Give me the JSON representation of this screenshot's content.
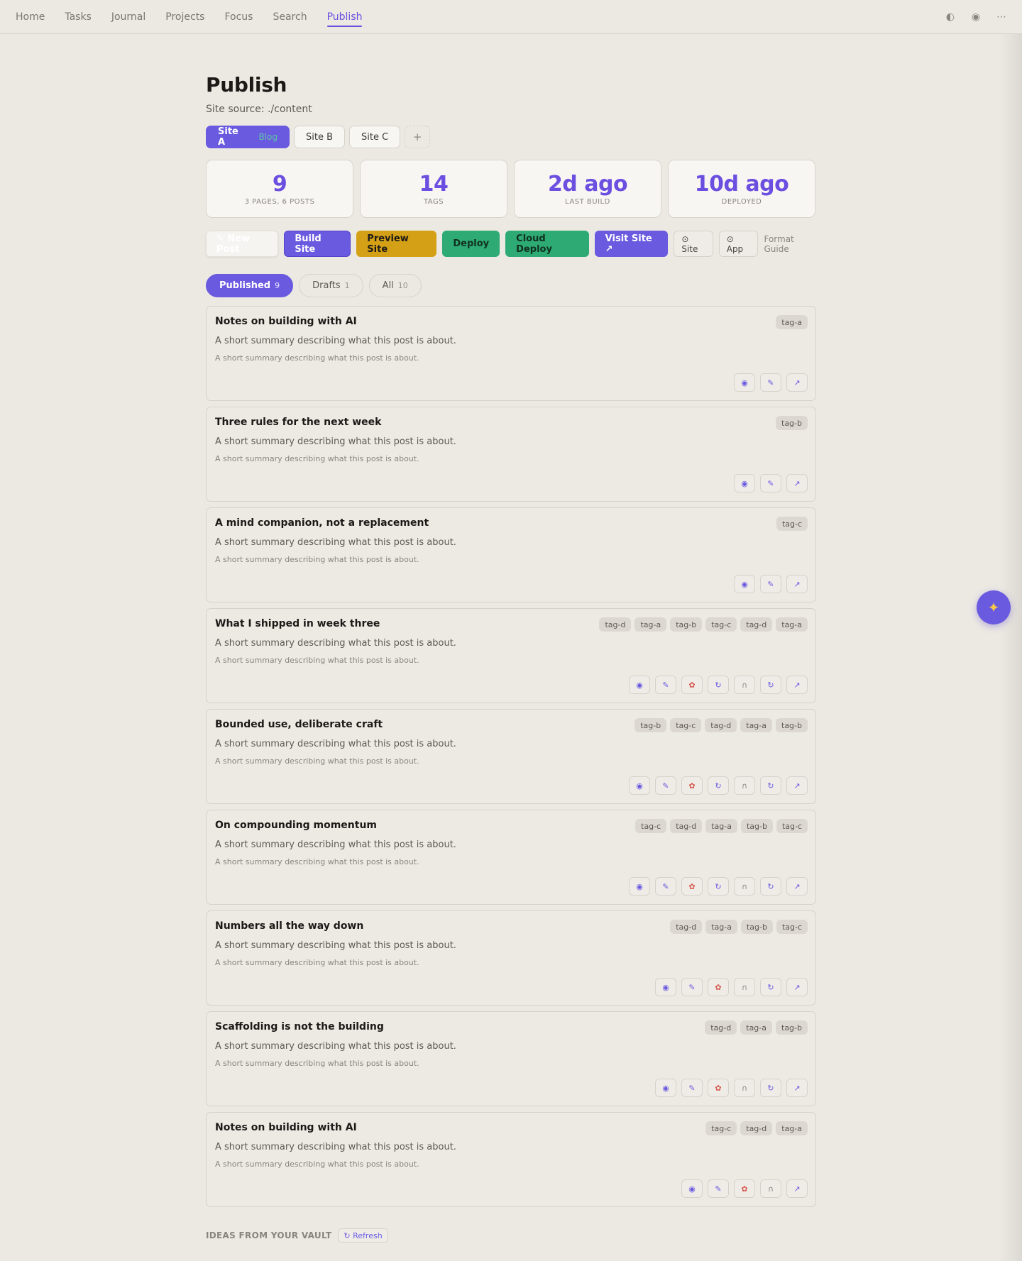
{
  "nav": {
    "items": [
      {
        "label": "Home"
      },
      {
        "label": "Tasks"
      },
      {
        "label": "Journal"
      },
      {
        "label": "Projects"
      },
      {
        "label": "Focus"
      },
      {
        "label": "Search"
      },
      {
        "label": "Publish",
        "active": true
      }
    ],
    "icons": [
      "theme-toggle-icon",
      "eye-icon",
      "more-icon"
    ],
    "icon_glyphs": [
      "◐",
      "◉",
      "⋯"
    ]
  },
  "page": {
    "title": "Publish",
    "site_source": "Site source: ./content"
  },
  "site_tabs": [
    {
      "label": "Site A",
      "badge": "Blog",
      "active": true
    },
    {
      "label": "Site B"
    },
    {
      "label": "Site C"
    }
  ],
  "add_site_label": "+",
  "stats": [
    {
      "value": "9",
      "label": "3 PAGES, 6 POSTS"
    },
    {
      "value": "14",
      "label": "TAGS"
    },
    {
      "value": "2d ago",
      "label": "LAST BUILD"
    },
    {
      "value": "10d ago",
      "label": "DEPLOYED"
    }
  ],
  "actions": {
    "new_post": "✎ New Post",
    "build": "Build Site",
    "preview": "Preview Site",
    "deploy": "Deploy",
    "cloud_deploy": "Cloud Deploy",
    "visit": "Visit Site ↗",
    "site": "⊙ Site",
    "app": "⊙ App",
    "format_guide": "Format Guide"
  },
  "filters": [
    {
      "label": "Published",
      "count": "9",
      "active": true
    },
    {
      "label": "Drafts",
      "count": "1"
    },
    {
      "label": "All",
      "count": "10"
    }
  ],
  "posts": [
    {
      "title": "Notes on building with AI",
      "summary": "A short summary describing what this post is about.",
      "sub": "A short summary describing what this post is about.",
      "tags": [
        "tag-a"
      ],
      "actions": [
        "view",
        "edit",
        "open"
      ]
    },
    {
      "title": "Three rules for the next week",
      "summary": "A short summary describing what this post is about.",
      "sub": "A short summary describing what this post is about.",
      "tags": [
        "tag-b"
      ],
      "actions": [
        "view",
        "edit",
        "open"
      ]
    },
    {
      "title": "A mind companion, not a replacement",
      "summary": "A short summary describing what this post is about.",
      "sub": "A short summary describing what this post is about.",
      "tags": [
        "tag-c"
      ],
      "actions": [
        "view",
        "edit",
        "open"
      ]
    },
    {
      "title": "What I shipped in week three",
      "summary": "A short summary describing what this post is about.",
      "sub": "A short summary describing what this post is about.",
      "tags": [
        "tag-d",
        "tag-a",
        "tag-b",
        "tag-c",
        "tag-d",
        "tag-a"
      ],
      "actions": [
        "view",
        "edit",
        "brain",
        "sync",
        "audio",
        "sync",
        "open"
      ]
    },
    {
      "title": "Bounded use, deliberate craft",
      "summary": "A short summary describing what this post is about.",
      "sub": "A short summary describing what this post is about.",
      "tags": [
        "tag-b",
        "tag-c",
        "tag-d",
        "tag-a",
        "tag-b"
      ],
      "actions": [
        "view",
        "edit",
        "brain",
        "sync",
        "audio",
        "sync",
        "open"
      ]
    },
    {
      "title": "On compounding momentum",
      "summary": "A short summary describing what this post is about.",
      "sub": "A short summary describing what this post is about.",
      "tags": [
        "tag-c",
        "tag-d",
        "tag-a",
        "tag-b",
        "tag-c"
      ],
      "actions": [
        "view",
        "edit",
        "brain",
        "sync",
        "audio",
        "sync",
        "open"
      ]
    },
    {
      "title": "Numbers all the way down",
      "summary": "A short summary describing what this post is about.",
      "sub": "A short summary describing what this post is about.",
      "tags": [
        "tag-d",
        "tag-a",
        "tag-b",
        "tag-c"
      ],
      "actions": [
        "view",
        "edit",
        "brain",
        "audio",
        "sync",
        "open"
      ]
    },
    {
      "title": "Scaffolding is not the building",
      "summary": "A short summary describing what this post is about.",
      "sub": "A short summary describing what this post is about.",
      "tags": [
        "tag-d",
        "tag-a",
        "tag-b"
      ],
      "actions": [
        "view",
        "edit",
        "brain",
        "audio",
        "sync",
        "open"
      ]
    },
    {
      "title": "Notes on building with AI",
      "summary": "A short summary describing what this post is about.",
      "sub": "A short summary describing what this post is about.",
      "tags": [
        "tag-c",
        "tag-d",
        "tag-a"
      ],
      "actions": [
        "view",
        "edit",
        "brain",
        "audio",
        "open"
      ]
    }
  ],
  "action_glyphs": {
    "view": "◉",
    "edit": "✎",
    "brain": "✿",
    "sync": "↻",
    "audio": "∩",
    "open": "↗"
  },
  "ideas": {
    "label": "IDEAS FROM YOUR VAULT",
    "refresh": "↻ Refresh"
  },
  "fab_glyph": "✦",
  "colors": {
    "accent": "#6a5ae0",
    "background": "#ece9e3",
    "preview": "#d4a016",
    "deploy": "#2eaa74"
  }
}
